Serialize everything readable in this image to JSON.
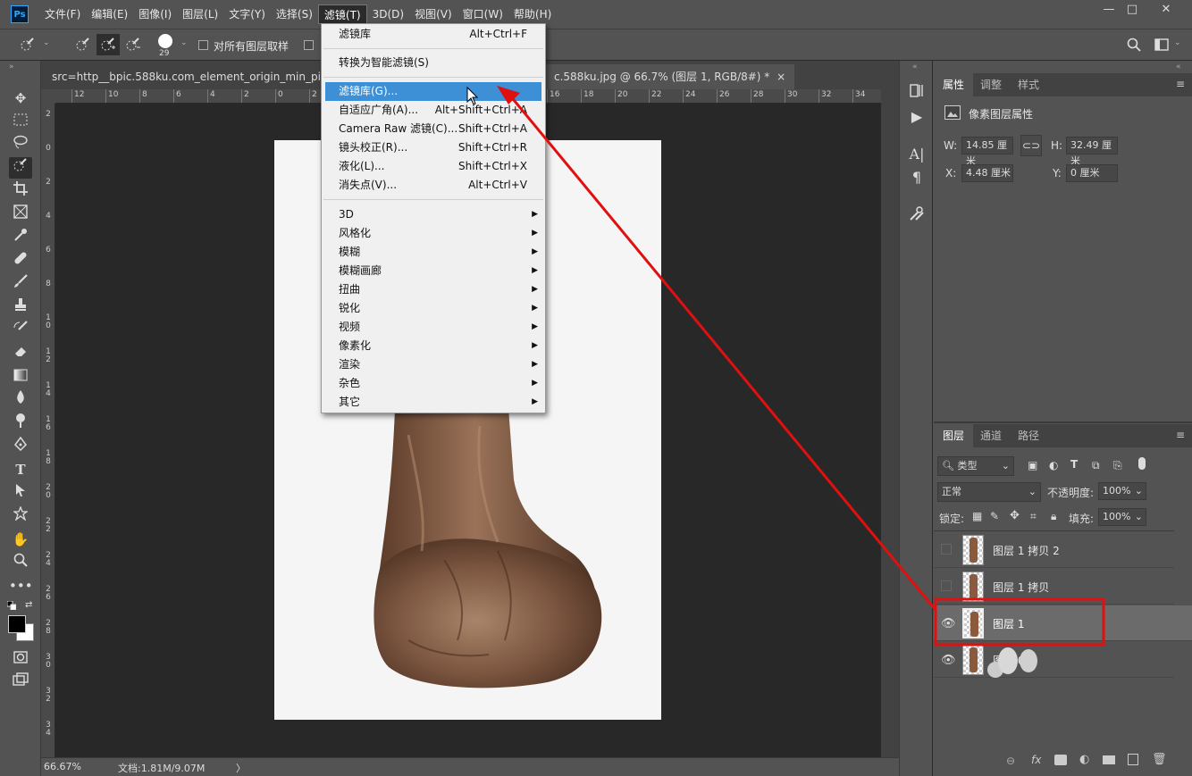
{
  "app": {
    "logo": "Ps",
    "menus": [
      "文件(F)",
      "编辑(E)",
      "图像(I)",
      "图层(L)",
      "文字(Y)",
      "选择(S)",
      "滤镜(T)",
      "3D(D)",
      "视图(V)",
      "窗口(W)",
      "帮助(H)"
    ],
    "window_controls": [
      "—",
      "□",
      "✕"
    ]
  },
  "options": {
    "brush_size": "29",
    "sample_all_layers": "对所有图层取样"
  },
  "document": {
    "tab_left": "src=http__bpic.588ku.com_element_origin_min_pic_20_1",
    "tab_right": "c.588ku.jpg @ 66.7% (图层 1, RGB/8#) *",
    "tab_close": "×",
    "ruler_h": [
      "12",
      "10",
      "8",
      "6",
      "4",
      "2",
      "0",
      "2",
      "4",
      "6",
      "8",
      "10",
      "12",
      "14",
      "16",
      "18",
      "20",
      "22",
      "24",
      "26",
      "28",
      "30",
      "32",
      "34"
    ],
    "ruler_v": [
      "2",
      "0",
      "2",
      "4",
      "6",
      "8",
      "1 0",
      "1 2",
      "1 4",
      "1 6",
      "1 8",
      "2 0",
      "2 2",
      "2 4",
      "2 6",
      "2 8",
      "3 0",
      "3 2",
      "3 4"
    ]
  },
  "status": {
    "zoom": "66.67%",
    "doc_size": "文档:1.81M/9.07M",
    "arrow": "〉"
  },
  "filter_menu": {
    "items_top": [
      {
        "label": "滤镜库",
        "shortcut": "Alt+Ctrl+F"
      }
    ],
    "smart": "转换为智能滤镜(S)",
    "items_mid": [
      {
        "label": "滤镜库(G)...",
        "shortcut": "",
        "highlight": true
      },
      {
        "label": "自适应广角(A)...",
        "shortcut": "Alt+Shift+Ctrl+A"
      },
      {
        "label": "Camera Raw 滤镜(C)...",
        "shortcut": "Shift+Ctrl+A"
      },
      {
        "label": "镜头校正(R)...",
        "shortcut": "Shift+Ctrl+R"
      },
      {
        "label": "液化(L)...",
        "shortcut": "Shift+Ctrl+X"
      },
      {
        "label": "消失点(V)...",
        "shortcut": "Alt+Ctrl+V"
      }
    ],
    "submenus": [
      "3D",
      "风格化",
      "模糊",
      "模糊画廊",
      "扭曲",
      "锐化",
      "视频",
      "像素化",
      "渲染",
      "杂色",
      "其它"
    ],
    "arrow": "▶"
  },
  "properties": {
    "tabs": [
      "属性",
      "调整",
      "样式"
    ],
    "title": "像素图层属性",
    "w_label": "W:",
    "w_value": "14.85 厘米",
    "h_label": "H:",
    "h_value": "32.49 厘米",
    "x_label": "X:",
    "x_value": "4.48 厘米",
    "y_label": "Y:",
    "y_value": "0 厘米"
  },
  "layers": {
    "tabs": [
      "图层",
      "通道",
      "路径"
    ],
    "filter_kind": "类型",
    "blend_mode": "正常",
    "opacity_label": "不透明度:",
    "opacity": "100%",
    "lock_label": "锁定:",
    "fill_label": "填充:",
    "fill": "100%",
    "items": [
      {
        "name": "图层 1 拷贝 2",
        "visible": false,
        "selected": false
      },
      {
        "name": "图层 1 拷贝",
        "visible": false,
        "selected": false
      },
      {
        "name": "图层 1",
        "visible": true,
        "selected": true
      },
      {
        "name": "图层 0",
        "visible": true,
        "selected": false
      }
    ]
  },
  "colors": {
    "highlight": "#3d8fd6",
    "annotation": "#e01010"
  }
}
